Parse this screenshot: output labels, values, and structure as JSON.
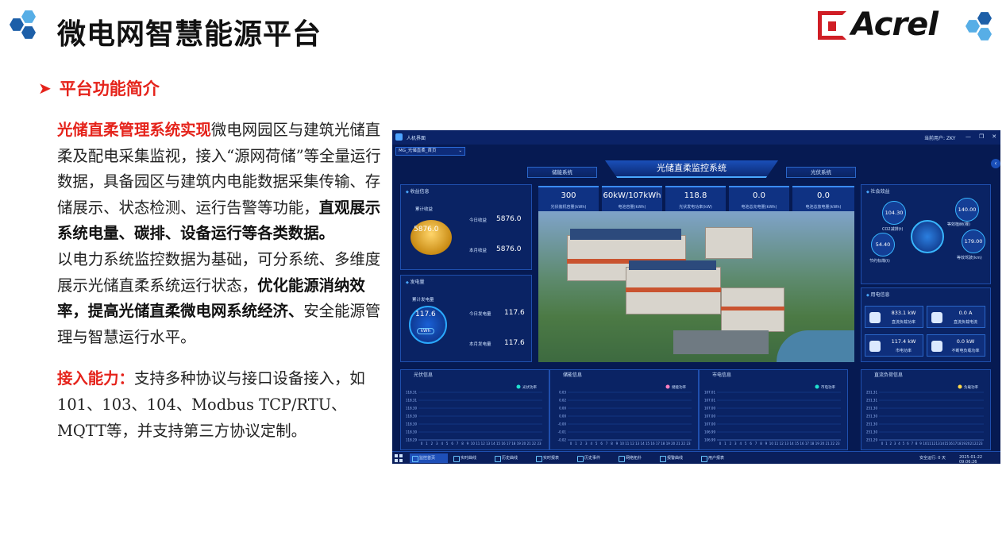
{
  "slide": {
    "title": "微电网智慧能源平台",
    "section": "平台功能简介",
    "logo_text": "Acrel"
  },
  "colors": {
    "accent_red": "#e5231b",
    "panel_blue": "#061a52",
    "hex_blue": "#1d5fa8",
    "hex_light": "#57aee6"
  },
  "paragraph1": {
    "lead": "光储直柔管理系统实现",
    "text": "微电网园区与建筑光储直柔及配电采集监视，接入“源网荷储”等全量运行数据，具备园区与建筑内电能数据采集传输、存储展示、状态检测、运行告警等功能，",
    "emphasis": "直观展示系统电量、碳排、设备运行等各类数据。"
  },
  "paragraph2": {
    "text": "以电力系统监控数据为基础，可分系统、多维度展示光储直柔系统运行状态，",
    "emphasis": "优化能源消纳效率，提高光储直柔微电网系统经济、",
    "tail": "安全能源管理与智慧运行水平。"
  },
  "paragraph3": {
    "label": "接入能力：",
    "text": "支持多种协议与接口设备接入，如101、103、104、Modbus TCP/RTU、MQTT等，并支持第三方协议定制。"
  },
  "screenshot": {
    "window_title": "人机界面",
    "user": "当前用户: ZKY",
    "win_buttons": [
      "—",
      "❐",
      "✕"
    ],
    "selector": "MG_光储直柔_首页",
    "nav_left": "储能系统",
    "nav_center": "光储直柔监控系统",
    "nav_right": "光伏系统",
    "income": {
      "title": "收益信息",
      "total_label": "累计收益",
      "total_value": "5876.0",
      "today_label": "今日收益",
      "today_value": "5876.0",
      "month_label": "本月收益",
      "month_value": "5876.0"
    },
    "generation": {
      "title": "发电量",
      "total_label": "累计发电量",
      "total_value": "117.6",
      "unit": "kWh",
      "today_label": "今日发电量",
      "today_value": "117.6",
      "month_label": "本月发电量",
      "month_value": "117.6"
    },
    "stats": [
      {
        "value": "300",
        "label": "光伏装机容量(kWh)"
      },
      {
        "value": "60kW/107kWh",
        "label": "电池容量(kWh)"
      },
      {
        "value": "118.8",
        "label": "光伏发电功率(kW)"
      },
      {
        "value": "0.0",
        "label": "电池总充电量(kWh)"
      },
      {
        "value": "0.0",
        "label": "电池总放电量(kWh)"
      }
    ],
    "social": {
      "title": "社会效益",
      "co2_value": "104.30",
      "co2_label": "CO2减排(t)",
      "tree_value": "140.00",
      "tree_label": "等效植树(棵)",
      "coal_value": "54.40",
      "coal_label": "节约标煤(t)",
      "oil_value": "179.00",
      "oil_label": "等效驾驶(km)"
    },
    "power": {
      "title": "用电信息",
      "dc_load_value": "833.1 kW",
      "dc_load_label": "直流负载功率",
      "dc_current_value": "0.0 A",
      "dc_current_label": "直流负载电流",
      "grid_value": "117.4 kW",
      "grid_label": "市电功率",
      "outage_value": "0.0 kW",
      "outage_label": "不断电负载功率"
    },
    "charts": [
      {
        "title": "光伏信息",
        "legend": "光伏功率",
        "legend_color": "#20e0d0",
        "yticks": [
          "118.31",
          "118.31",
          "118.30",
          "118.30",
          "118.30",
          "118.30",
          "118.29"
        ]
      },
      {
        "title": "储能信息",
        "legend": "储能功率",
        "legend_color": "#ff7fc0",
        "yticks": [
          "0.03",
          "0.02",
          "0.00",
          "0.00",
          "-0.00",
          "-0.01",
          "-0.02"
        ]
      },
      {
        "title": "市电信息",
        "legend": "市电功率",
        "legend_color": "#20e0d0",
        "yticks": [
          "107.01",
          "107.01",
          "107.00",
          "107.00",
          "107.00",
          "106.99",
          "106.99"
        ]
      },
      {
        "title": "直流负荷信息",
        "legend": "负载功率",
        "legend_color": "#ffd84a",
        "yticks": [
          "251.31",
          "251.31",
          "251.30",
          "251.30",
          "251.30",
          "251.30",
          "251.29"
        ]
      }
    ],
    "chart_data": [
      {
        "type": "line",
        "title": "光伏信息",
        "x": [
          "0",
          "1",
          "2",
          "3",
          "4",
          "5",
          "6",
          "7",
          "8",
          "9",
          "10",
          "11",
          "12",
          "13",
          "14",
          "15",
          "16",
          "17",
          "18",
          "19",
          "20",
          "21",
          "22",
          "23"
        ],
        "series": [
          {
            "name": "光伏功率",
            "values": []
          }
        ],
        "ylim": [
          118.29,
          118.31
        ]
      },
      {
        "type": "line",
        "title": "储能信息",
        "x": [
          "0",
          "1",
          "2",
          "3",
          "4",
          "5",
          "6",
          "7",
          "8",
          "9",
          "10",
          "11",
          "12",
          "13",
          "14",
          "15",
          "16",
          "17",
          "18",
          "19",
          "20",
          "21",
          "22",
          "23"
        ],
        "series": [
          {
            "name": "储能功率",
            "values": []
          }
        ],
        "ylim": [
          -0.02,
          0.03
        ]
      },
      {
        "type": "line",
        "title": "市电信息",
        "x": [
          "0",
          "1",
          "2",
          "3",
          "4",
          "5",
          "6",
          "7",
          "8",
          "9",
          "10",
          "11",
          "12",
          "13",
          "14",
          "15",
          "16",
          "17",
          "18",
          "19",
          "20",
          "21",
          "22",
          "23"
        ],
        "series": [
          {
            "name": "市电功率",
            "values": []
          }
        ],
        "ylim": [
          106.99,
          107.01
        ]
      },
      {
        "type": "line",
        "title": "直流负荷信息",
        "x": [
          "0",
          "1",
          "2",
          "3",
          "4",
          "5",
          "6",
          "7",
          "8",
          "9",
          "10",
          "11",
          "12",
          "13",
          "14",
          "15",
          "16",
          "17",
          "18",
          "19",
          "20",
          "21",
          "22",
          "23"
        ],
        "series": [
          {
            "name": "负载功率",
            "values": []
          }
        ],
        "ylim": [
          251.29,
          251.31
        ]
      }
    ],
    "taskbar": {
      "items": [
        "监控首页",
        "实时曲线",
        "历史曲线",
        "实时报表",
        "历史事件",
        "网络拓扑",
        "报警曲线",
        "用户报表"
      ],
      "status": "安全运行: 0 天",
      "time": "2025-01-22 09:06:26"
    }
  }
}
